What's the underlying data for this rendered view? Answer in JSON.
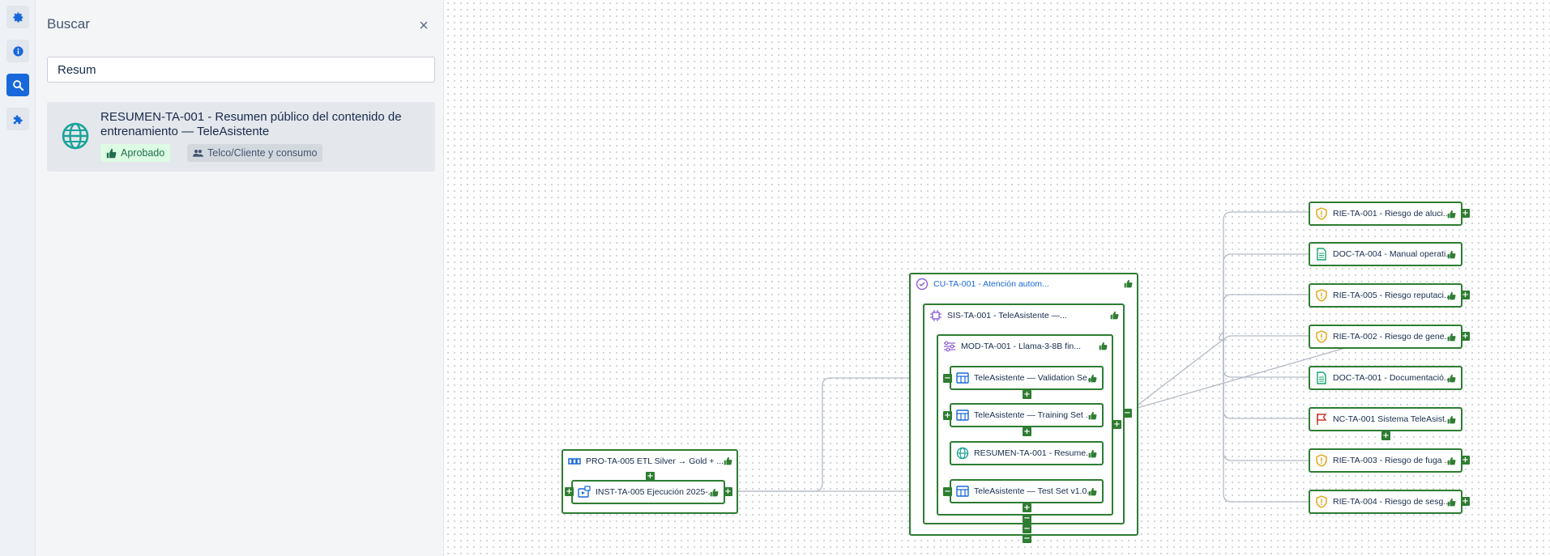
{
  "colors": {
    "accent": "#1868db",
    "node_border": "#2e7d32",
    "approved_bg": "#dcfce3"
  },
  "rail": {
    "items": [
      {
        "icon": "gear-icon",
        "active": false
      },
      {
        "icon": "info-icon",
        "active": false
      },
      {
        "icon": "search-icon",
        "active": true
      },
      {
        "icon": "puzzle-icon",
        "active": false
      }
    ]
  },
  "search": {
    "title": "Buscar",
    "close_label": "×",
    "query": "Resum",
    "results": [
      {
        "icon": "globe-icon",
        "title": "RESUMEN-TA-001 - Resumen público del contenido de entrenamiento — TeleAsistente",
        "status": "Aprobado",
        "group": "Telco/Cliente y consumo"
      }
    ]
  },
  "graph": {
    "nodes": {
      "pro": "PRO-TA-005 ETL Silver → Gold + ...",
      "inst": "INST-TA-005 Ejecución 2025-...",
      "cu": "CU-TA-001 - Atención autom...",
      "sis": "SIS-TA-001 - TeleAsistente —...",
      "mod": "MOD-TA-001 - Llama-3-8B fin...",
      "validation": "TeleAsistente — Validation Se...",
      "training": "TeleAsistente — Training Set ...",
      "resumen": "RESUMEN-TA-001 - Resume...",
      "test": "TeleAsistente — Test Set v1.0...",
      "rie1": "RIE-TA-001 - Riesgo de aluci...",
      "doc4": "DOC-TA-004 - Manual operati...",
      "rie5": "RIE-TA-005 - Riesgo reputaci...",
      "rie2": "RIE-TA-002 - Riesgo de gene...",
      "doc1": "DOC-TA-001 - Documentació...",
      "nc1": "NC-TA-001 Sistema TeleAsist...",
      "rie3": "RIE-TA-003 - Riesgo de fuga ...",
      "rie4": "RIE-TA-004 - Riesgo de sesg..."
    },
    "toggles": {
      "expand": "+",
      "collapse": "−"
    }
  }
}
